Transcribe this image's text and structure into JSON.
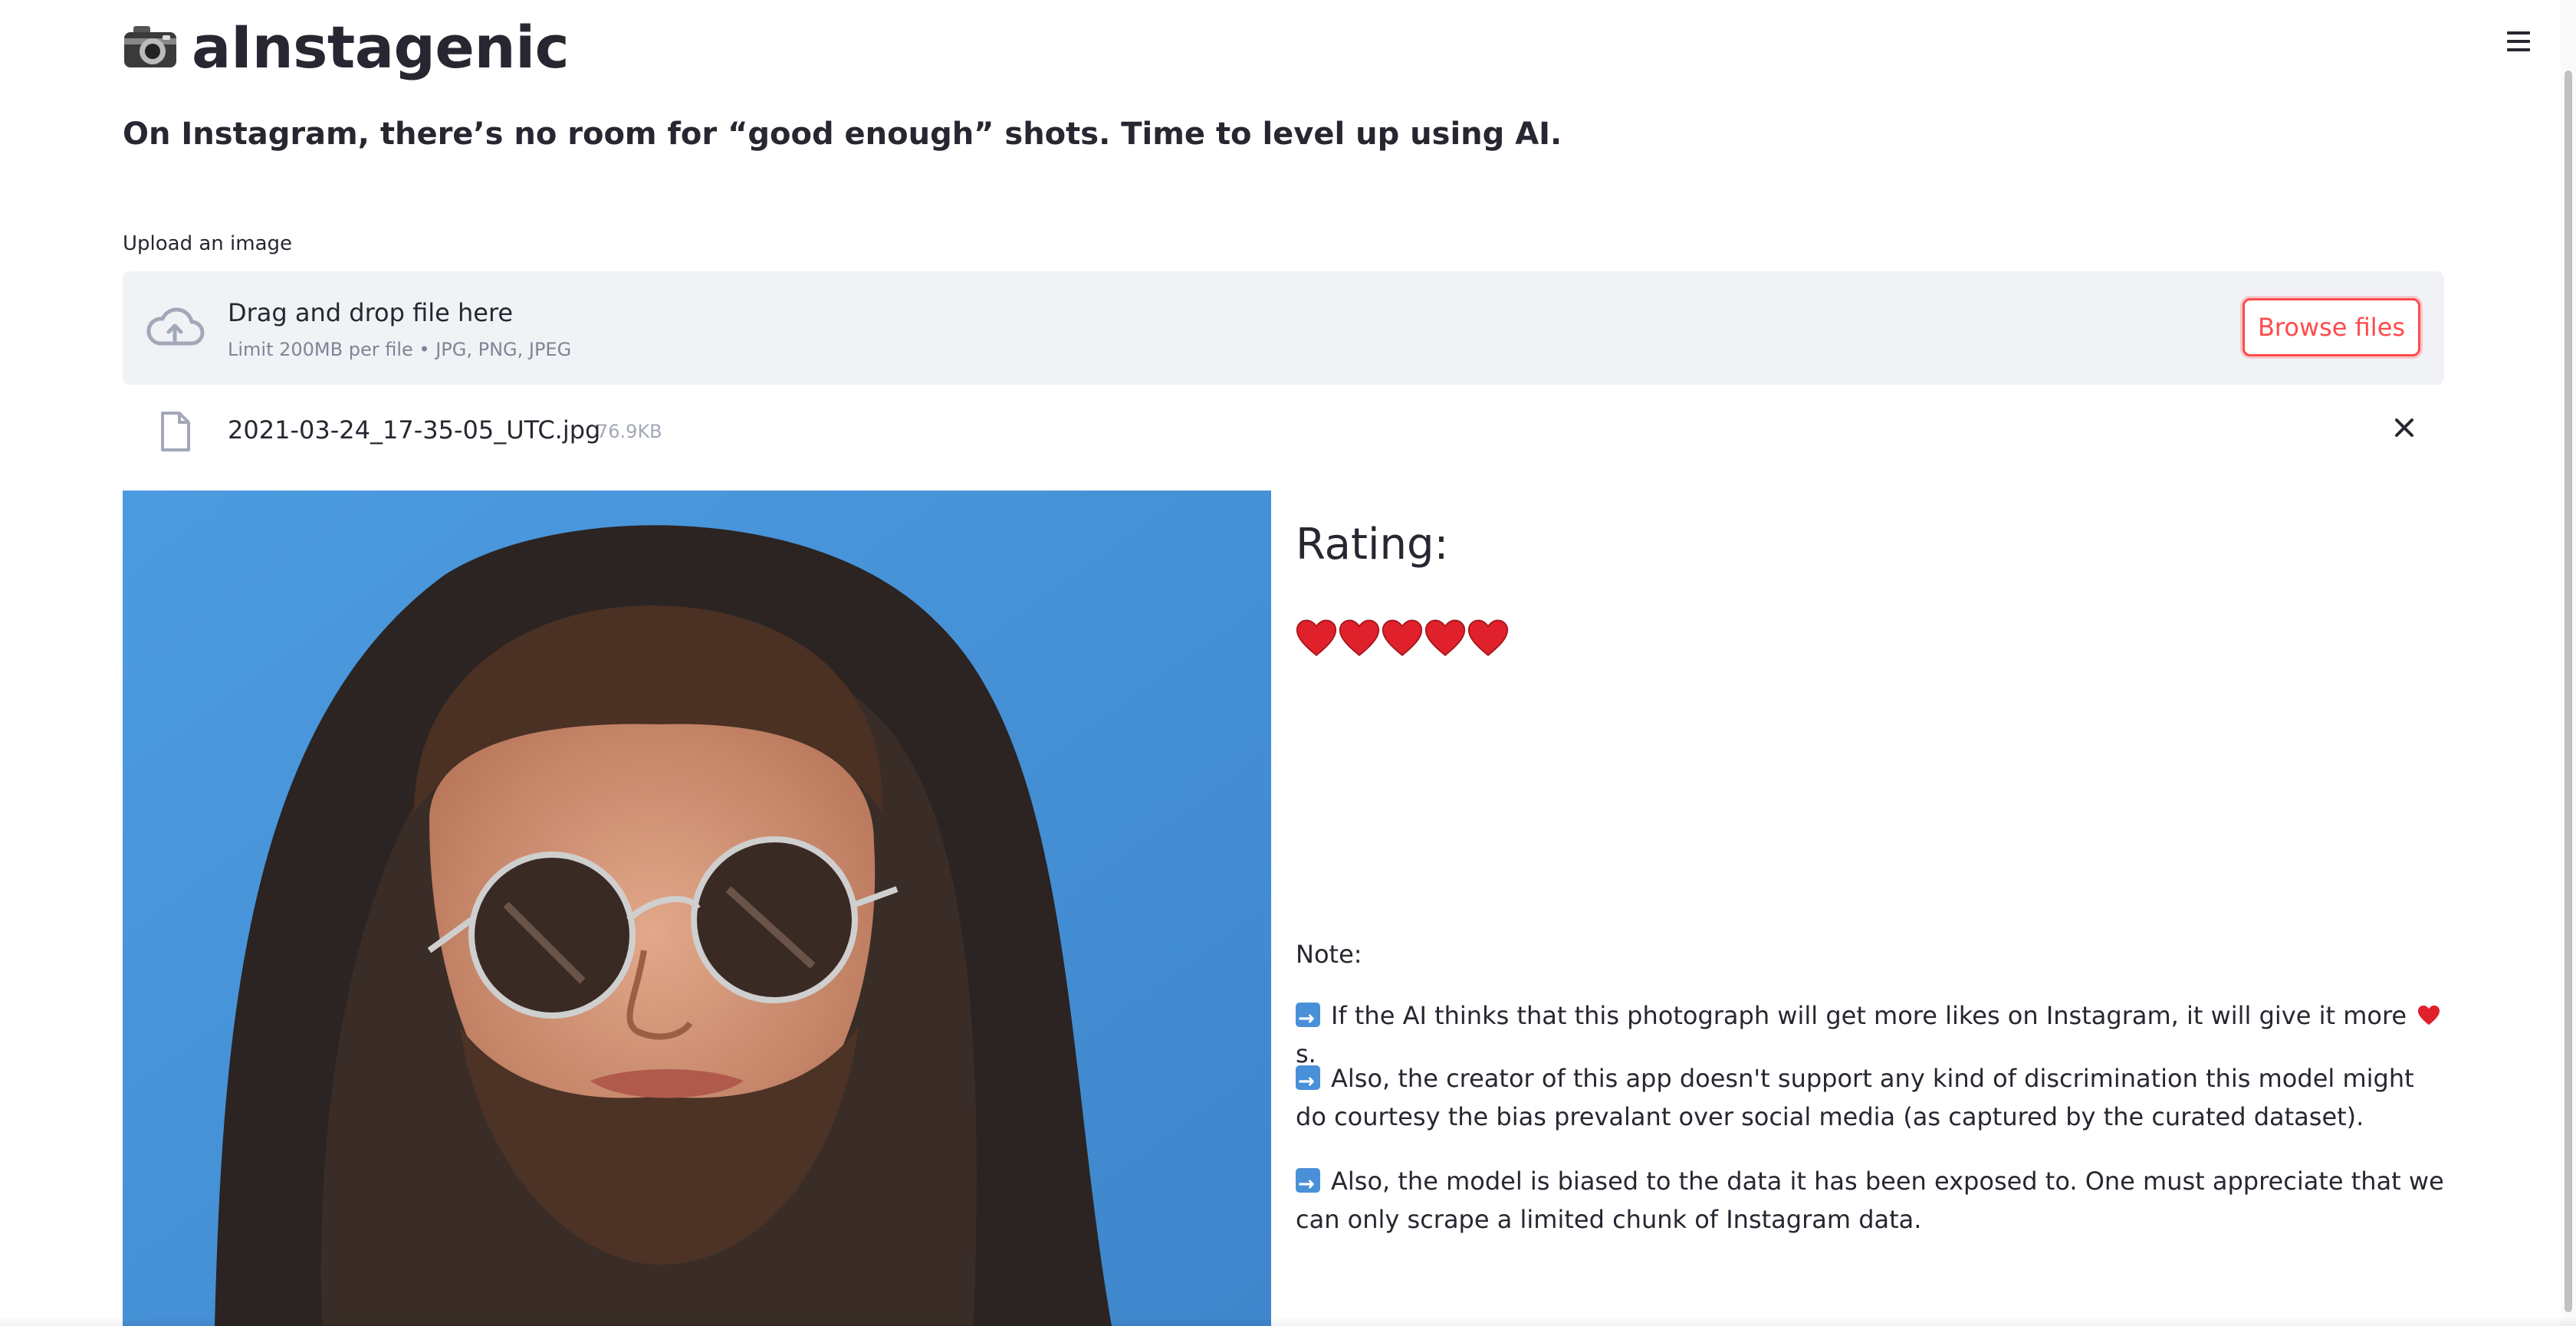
{
  "header": {
    "title": "aInstagenic",
    "logo_icon": "camera-icon",
    "menu_icon": "hamburger-menu-icon"
  },
  "subtitle": "On Instagram, there’s no room for “good enough” shots. Time to level up using AI.",
  "uploader": {
    "label": "Upload an image",
    "dropzone_title": "Drag and drop file here",
    "dropzone_hint": "Limit 200MB per file • JPG, PNG, JPEG",
    "browse_label": "Browse files",
    "accent_color": "#ff4b4b"
  },
  "uploaded_file": {
    "name": "2021-03-24_17-35-05_UTC.jpg",
    "size": "76.9KB"
  },
  "result": {
    "rating_title": "Rating:",
    "hearts_count": 5,
    "heart_color": "#e0202a"
  },
  "notes": {
    "label": "Note:",
    "items": [
      {
        "before_heart": "If the AI thinks that this photograph will get more likes on Instagram, it will give it more",
        "after_heart": "s."
      },
      {
        "text": "Also, the creator of this app doesn't support any kind of discrimination this model might do courtesy the bias prevalant over social media (as captured by the curated dataset)."
      },
      {
        "text": "Also, the model is biased to the data it has been exposed to. One must appreciate that we can only scrape a limited chunk of Instagram data."
      }
    ]
  }
}
